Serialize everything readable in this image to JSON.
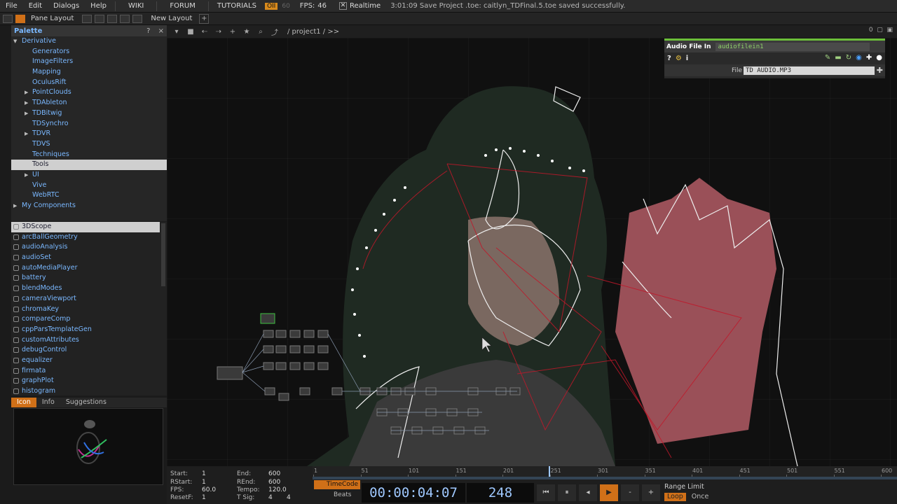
{
  "menu": {
    "items": [
      "File",
      "Edit",
      "Dialogs",
      "Help"
    ],
    "wiki": "WIKI",
    "forum": "FORUM",
    "tutorials": "TUTORIALS",
    "perf": "OII",
    "perf2": "60",
    "fps_label": "FPS:",
    "fps_value": "46",
    "realtime": "Realtime",
    "status": "3:01:09 Save Project .toe: caitlyn_TDFinal.5.toe saved successfully."
  },
  "layoutbar": {
    "pane_layout": "Pane Layout",
    "new_layout": "New Layout",
    "plus": "+"
  },
  "palette": {
    "title": "Palette",
    "help": "?",
    "close": "×",
    "tree": [
      {
        "label": "Derivative",
        "depth": 0,
        "expander": "open"
      },
      {
        "label": "Generators",
        "depth": 1,
        "expander": ""
      },
      {
        "label": "ImageFilters",
        "depth": 1,
        "expander": ""
      },
      {
        "label": "Mapping",
        "depth": 1,
        "expander": ""
      },
      {
        "label": "OculusRift",
        "depth": 1,
        "expander": ""
      },
      {
        "label": "PointClouds",
        "depth": 1,
        "expander": "closed"
      },
      {
        "label": "TDAbleton",
        "depth": 1,
        "expander": "closed"
      },
      {
        "label": "TDBitwig",
        "depth": 1,
        "expander": "closed"
      },
      {
        "label": "TDSynchro",
        "depth": 1,
        "expander": ""
      },
      {
        "label": "TDVR",
        "depth": 1,
        "expander": "closed"
      },
      {
        "label": "TDVS",
        "depth": 1,
        "expander": ""
      },
      {
        "label": "Techniques",
        "depth": 1,
        "expander": ""
      },
      {
        "label": "Tools",
        "depth": 1,
        "expander": "",
        "selected": true
      },
      {
        "label": "UI",
        "depth": 1,
        "expander": "closed"
      },
      {
        "label": "Vive",
        "depth": 1,
        "expander": ""
      },
      {
        "label": "WebRTC",
        "depth": 1,
        "expander": ""
      },
      {
        "label": "My Components",
        "depth": 0,
        "expander": "closed"
      }
    ]
  },
  "components": [
    "3DScope",
    "arcBallGeometry",
    "audioAnalysis",
    "audioSet",
    "autoMediaPlayer",
    "battery",
    "blendModes",
    "cameraViewport",
    "chromaKey",
    "compareComp",
    "cppParsTemplateGen",
    "customAttributes",
    "debugControl",
    "equalizer",
    "firmata",
    "graphPlot",
    "histogram"
  ],
  "icontabs": {
    "icon": "Icon",
    "info": "Info",
    "suggestions": "Suggestions"
  },
  "network": {
    "path": "/ project1 / >>",
    "counter": "0"
  },
  "param": {
    "title": "Audio File In",
    "name": "audiofilein1",
    "file_label": "File",
    "file_value": "TD AUDIO.MP3",
    "help": "?",
    "info": "i"
  },
  "timeline": {
    "start_label": "Start:",
    "start": "1",
    "rstart_label": "RStart:",
    "rstart": "1",
    "fps_label": "FPS:",
    "fps": "60.0",
    "resetf_label": "ResetF:",
    "resetf": "1",
    "end_label": "End:",
    "end": "600",
    "rend_label": "REnd:",
    "rend": "600",
    "tempo_label": "Tempo:",
    "tempo": "120.0",
    "tsig_label": "T Sig:",
    "tsig_a": "4",
    "tsig_b": "4",
    "ticks": [
      "1",
      "51",
      "101",
      "151",
      "201",
      "251",
      "301",
      "351",
      "401",
      "451",
      "501",
      "551",
      "600"
    ],
    "timecode_btn": "TimeCode",
    "beats_btn": "Beats",
    "timecode": "00:00:04:07",
    "frame": "248",
    "playhead_fraction": 0.413,
    "range_limit": "Range Limit",
    "loop": "Loop",
    "once": "Once"
  },
  "colors": {
    "accent": "#d07018",
    "link": "#7ab8ff",
    "param_green": "#6cbf3a",
    "wire_red": "#c0182a"
  }
}
